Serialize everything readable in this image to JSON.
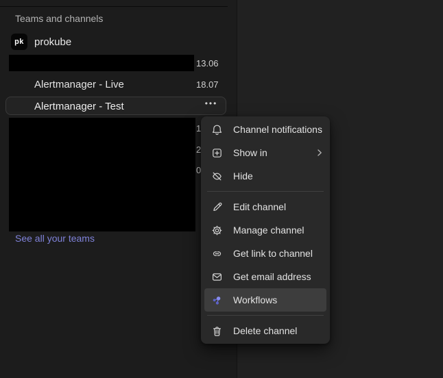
{
  "sidebar": {
    "section_header": "Teams and channels",
    "team": {
      "avatar": "pk",
      "name": "prokube"
    },
    "channel_rows": [
      {
        "name": "",
        "redacted": true,
        "time": "13.06"
      },
      {
        "name": "Alertmanager - Live",
        "time": "18.07"
      },
      {
        "name": "Alertmanager - Test",
        "selected": true,
        "actions": "•••"
      }
    ],
    "hidden_rows_partial_times": [
      "1",
      "2",
      "0"
    ],
    "see_all_teams": "See all your teams"
  },
  "context_menu": {
    "items": [
      {
        "icon": "bell-icon",
        "label": "Channel notifications"
      },
      {
        "icon": "plus-square-icon",
        "label": "Show in",
        "has_submenu": true
      },
      {
        "icon": "eye-off-icon",
        "label": "Hide"
      },
      {
        "icon": "pencil-icon",
        "label": "Edit channel"
      },
      {
        "icon": "gear-icon",
        "label": "Manage channel"
      },
      {
        "icon": "link-icon",
        "label": "Get link to channel"
      },
      {
        "icon": "mail-icon",
        "label": "Get email address"
      },
      {
        "icon": "workflows-icon",
        "label": "Workflows",
        "highlighted": true
      },
      {
        "icon": "trash-icon",
        "label": "Delete channel"
      }
    ]
  },
  "colors": {
    "sidebar_bg": "#1c1c1c",
    "main_bg": "#212121",
    "menu_bg": "#292929",
    "menu_highlight": "#3d3d3d",
    "selected_row_border": "#3a3a3a",
    "link": "#7f82d9",
    "workflow_icon_light": "#878cf0",
    "workflow_icon_dark": "#5d62c8"
  }
}
